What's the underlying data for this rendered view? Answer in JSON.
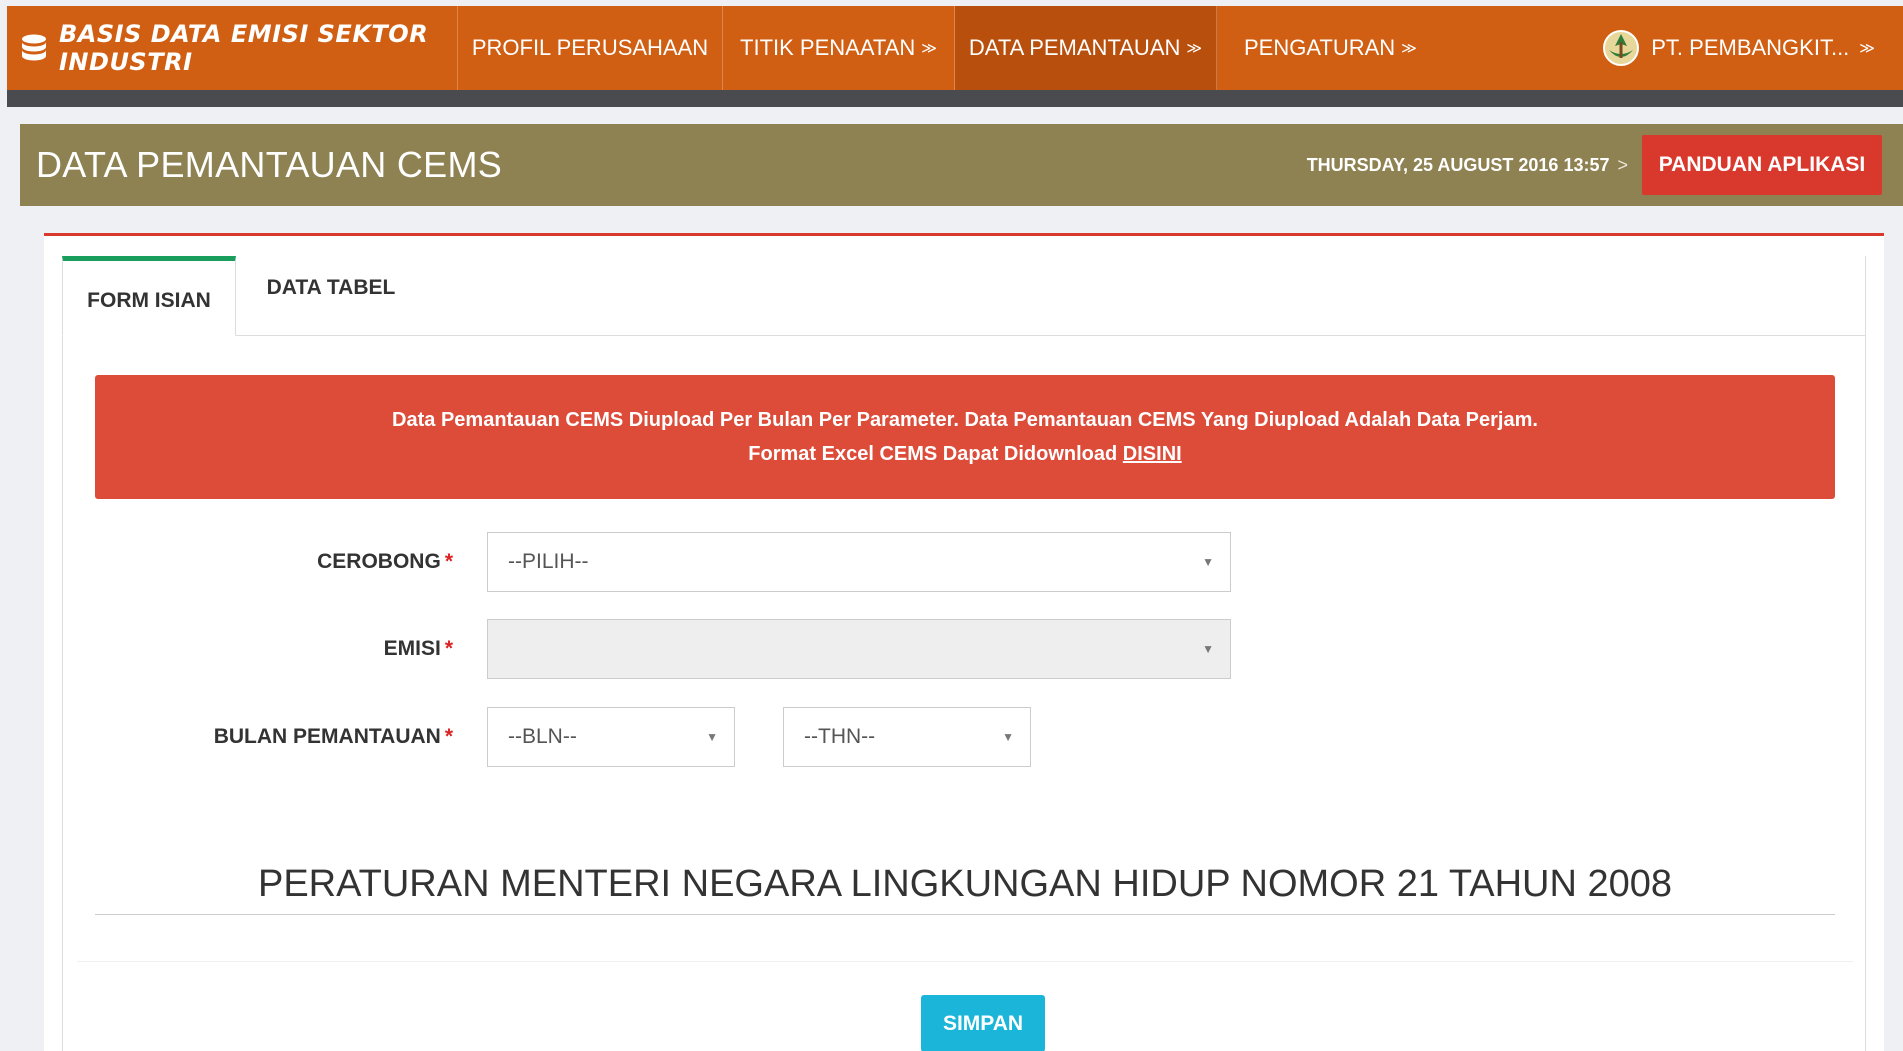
{
  "nav": {
    "brand": "BASIS DATA EMISI SEKTOR INDUSTRI",
    "brand_icon": "database-icon",
    "items": [
      {
        "label": "PROFIL PERUSAHAAN",
        "chevron": ""
      },
      {
        "label": "TITIK PENAATAN",
        "chevron": "≫"
      },
      {
        "label": "DATA PEMANTAUAN",
        "chevron": "≫"
      },
      {
        "label": "PENGATURAN",
        "chevron": "≫"
      }
    ],
    "active_item": "DATA PEMANTAUAN",
    "user": "PT. PEMBANGKIT...",
    "user_chevron": "≫",
    "user_icon": "ministry-emblem-icon"
  },
  "header": {
    "title": "DATA PEMANTAUAN CEMS",
    "datetime": "THURSDAY, 25 AUGUST 2016 13:57",
    "datetime_sep": ">",
    "guide_button": "PANDUAN APLIKASI"
  },
  "tabs": {
    "form": "FORM ISIAN",
    "table": "DATA TABEL",
    "active": "FORM ISIAN"
  },
  "alert": {
    "line1": "Data Pemantauan CEMS Diupload Per Bulan Per Parameter. Data Pemantauan CEMS Yang Diupload Adalah Data Perjam.",
    "line2_prefix": "Format Excel CEMS Dapat Didownload",
    "link": "DISINI"
  },
  "form": {
    "cerobong": {
      "label": "CEROBONG",
      "required": "*",
      "value": "--PILIH--"
    },
    "emisi": {
      "label": "EMISI",
      "required": "*",
      "value": ""
    },
    "bulan": {
      "label": "BULAN PEMANTAUAN",
      "required": "*",
      "month_value": "--BLN--",
      "year_value": "--THN--"
    }
  },
  "regulation": "PERATURAN MENTERI NEGARA LINGKUNGAN HIDUP NOMOR 21 TAHUN 2008",
  "save_button": "SIMPAN",
  "colors": {
    "nav_bg": "#d05f13",
    "header_bg": "#8e8152",
    "alert_bg": "#dd4b39",
    "guide_btn": "#d9382c",
    "tab_accent": "#1a9e5e",
    "save_btn": "#1ab5d9"
  }
}
